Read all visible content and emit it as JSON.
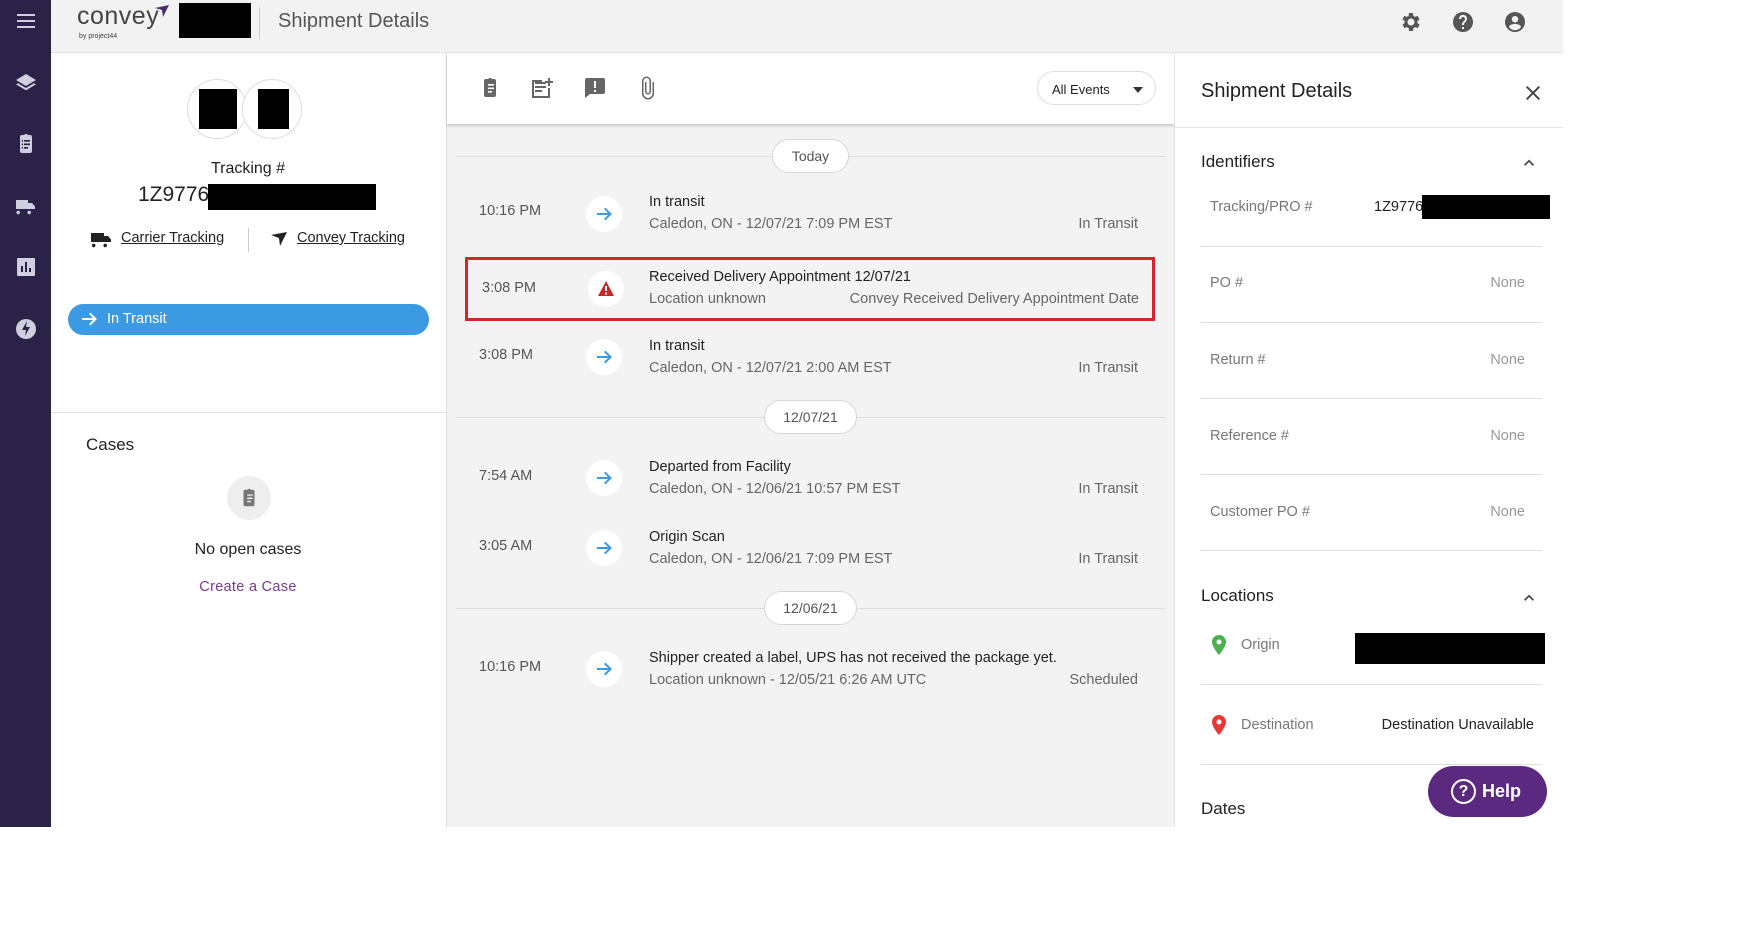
{
  "app": {
    "logo_text": "convey",
    "logo_subtext": "by project44",
    "page_title": "Shipment Details"
  },
  "left": {
    "tracking_label": "Tracking #",
    "tracking_number": "1Z9776",
    "carrier_tracking": "Carrier Tracking",
    "convey_tracking": "Convey Tracking",
    "status": "In Transit",
    "cases_title": "Cases",
    "no_cases": "No open cases",
    "create_case": "Create a Case"
  },
  "center": {
    "filter_value": "All Events",
    "separators": [
      "Today",
      "12/07/21",
      "12/06/21"
    ],
    "events": [
      {
        "time": "10:16 PM",
        "title": "In transit",
        "subtitle": "Caledon, ON - 12/07/21 7:09 PM EST",
        "status": "In Transit",
        "icon": "arrow-right-icon"
      },
      {
        "time": "3:08 PM",
        "title": "Received Delivery Appointment 12/07/21",
        "subtitle": "Location unknown",
        "status": "Convey Received Delivery Appointment Date",
        "icon": "warning-icon"
      },
      {
        "time": "3:08 PM",
        "title": "In transit",
        "subtitle": "Caledon, ON - 12/07/21 2:00 AM EST",
        "status": "In Transit",
        "icon": "arrow-right-icon"
      },
      {
        "time": "7:54 AM",
        "title": "Departed from Facility",
        "subtitle": "Caledon, ON - 12/06/21 10:57 PM EST",
        "status": "In Transit",
        "icon": "arrow-right-icon"
      },
      {
        "time": "3:05 AM",
        "title": "Origin Scan",
        "subtitle": "Caledon, ON - 12/06/21 7:09 PM EST",
        "status": "In Transit",
        "icon": "arrow-right-icon"
      },
      {
        "time": "10:16 PM",
        "title": "Shipper created a label, UPS has not received the package yet.",
        "subtitle": "Location unknown - 12/05/21 6:26 AM UTC",
        "status": "Scheduled",
        "icon": "arrow-right-icon"
      }
    ]
  },
  "right": {
    "title": "Shipment Details",
    "identifiers_title": "Identifiers",
    "identifiers": [
      {
        "label": "Tracking/PRO #",
        "value": "1Z9776"
      },
      {
        "label": "PO #",
        "value": "None"
      },
      {
        "label": "Return #",
        "value": "None"
      },
      {
        "label": "Reference #",
        "value": "None"
      },
      {
        "label": "Customer PO #",
        "value": "None"
      }
    ],
    "locations_title": "Locations",
    "origin_label": "Origin",
    "destination_label": "Destination",
    "destination_value": "Destination Unavailable",
    "dates_title": "Dates"
  },
  "help": {
    "label": "Help",
    "glyph": "?"
  },
  "colors": {
    "rail": "#2b2248",
    "status_pill": "#3b9ae1",
    "highlight": "#d8232a",
    "link_purple": "#7b3a8e",
    "help_button": "#5b2a80",
    "origin_pin": "#4caf50",
    "destination_pin": "#e53935"
  }
}
